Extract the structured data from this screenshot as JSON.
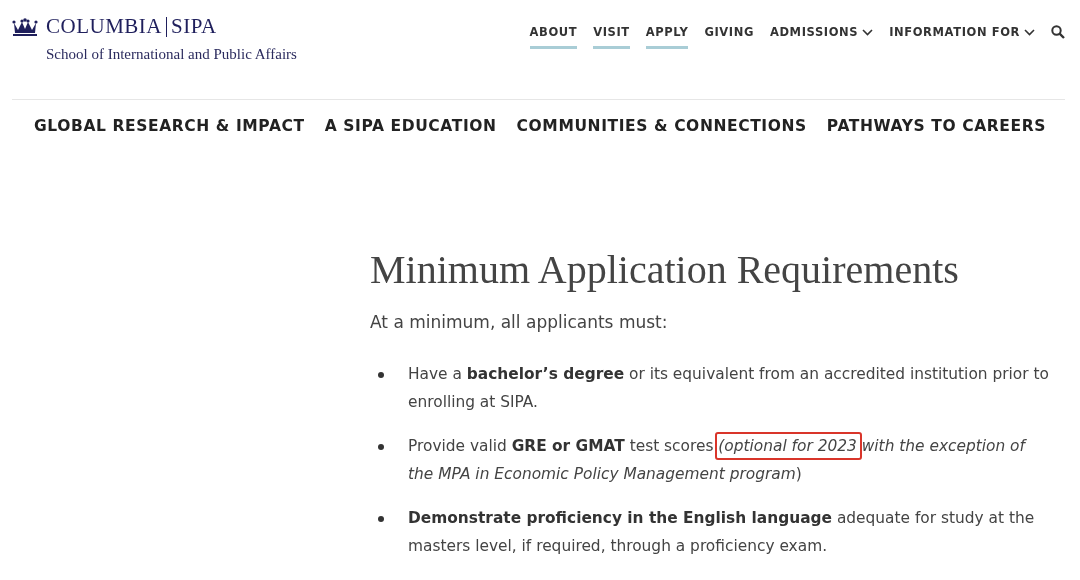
{
  "logo": {
    "name": "COLUMBIA",
    "unit": "SIPA",
    "subtitle": "School of International and Public Affairs"
  },
  "utility_nav": [
    {
      "label": "ABOUT",
      "underlined": true,
      "dropdown": false
    },
    {
      "label": "VISIT",
      "underlined": true,
      "dropdown": false
    },
    {
      "label": "APPLY",
      "underlined": true,
      "dropdown": false
    },
    {
      "label": "GIVING",
      "underlined": false,
      "dropdown": false
    },
    {
      "label": "ADMISSIONS",
      "underlined": false,
      "dropdown": true
    },
    {
      "label": "INFORMATION FOR",
      "underlined": false,
      "dropdown": true
    }
  ],
  "main_nav": [
    "GLOBAL RESEARCH & IMPACT",
    "A SIPA EDUCATION",
    "COMMUNITIES & CONNECTIONS",
    "PATHWAYS TO CAREERS"
  ],
  "heading": "Minimum Application Requirements",
  "intro": "At a minimum, all applicants must:",
  "requirements": [
    {
      "text": "Have a **bachelor’s degree** or its equivalent from an accredited institution prior to enrolling at SIPA."
    },
    {
      "text": "Provide valid **GRE or GMAT** test scores ",
      "highlighted": "*(optional for 2023*",
      "text_after": " *with the exception of the MPA in Economic Policy Management program*)"
    },
    {
      "text": "**Demonstrate proficiency in the English language** adequate for study at the masters level, if required, through a proficiency exam."
    }
  ]
}
